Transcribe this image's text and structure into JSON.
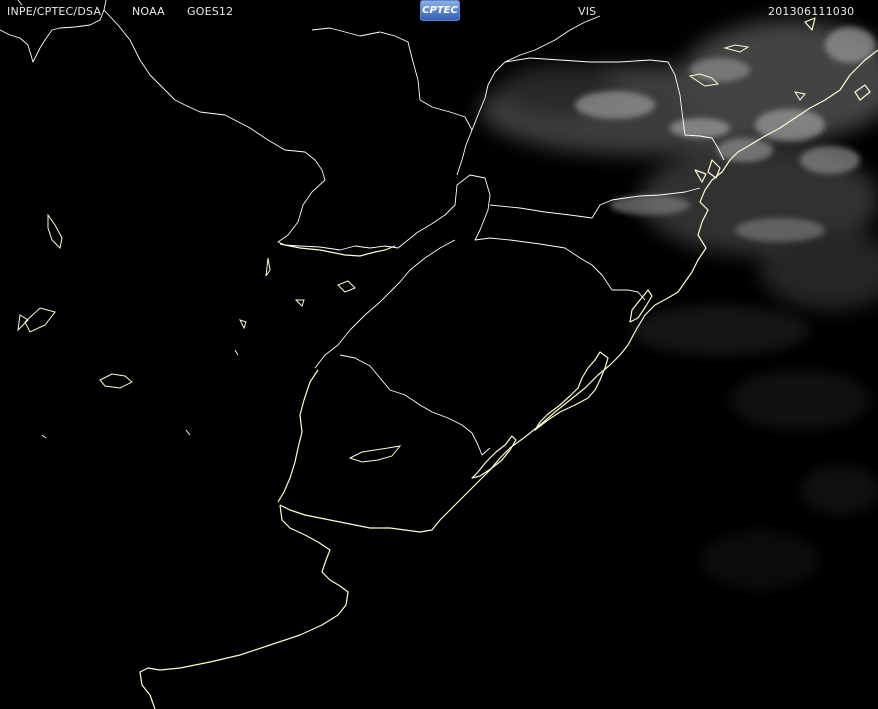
{
  "header": {
    "agency": "INPE/CPTEC/DSA",
    "source": "NOAA",
    "satellite": "GOES12",
    "logo_text": "CPTEC",
    "channel": "VIS",
    "timestamp": "201306111030"
  },
  "colors": {
    "background": "#000000",
    "coastline": "#fffbd0",
    "borders": "#ffffff",
    "clouds": "#8a8a8a",
    "logo": "#2d59b0"
  },
  "map": {
    "region": "Southern Brazil, Uruguay, Argentina",
    "imagery": "visible-satellite",
    "cloud_cover_location": "northeast"
  }
}
